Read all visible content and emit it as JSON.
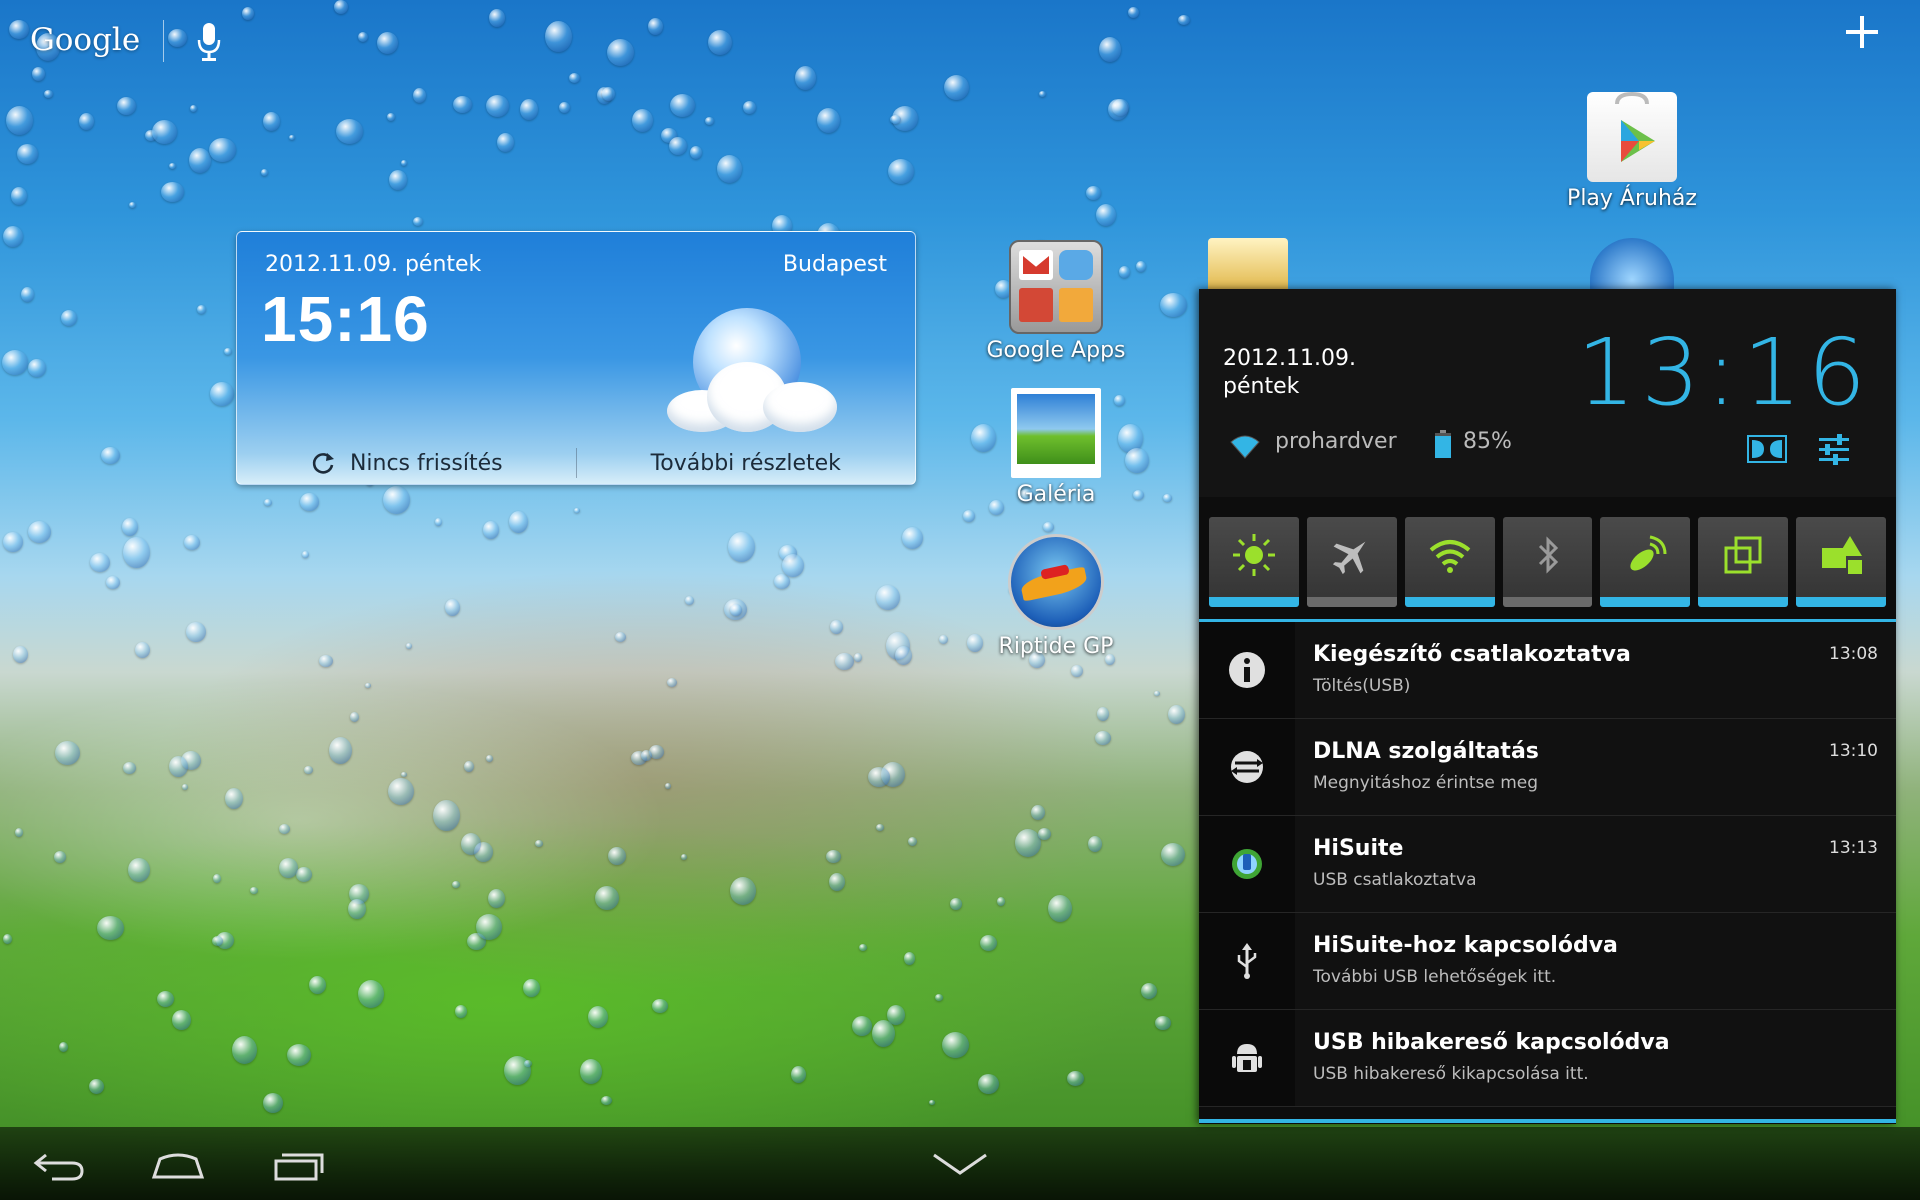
{
  "search_bar": {
    "logo_text": "Google"
  },
  "weather_widget": {
    "date": "2012.11.09.  péntek",
    "city": "Budapest",
    "time": "15:16",
    "refresh_label": "Nincs frissítés",
    "details_label": "További részletek"
  },
  "apps": [
    {
      "label": "Play Áruház",
      "icon": "play-store-icon"
    },
    {
      "label": "Google Apps",
      "icon": "google-apps-folder-icon"
    },
    {
      "label": "Galéria",
      "icon": "gallery-icon"
    },
    {
      "label": "Riptide GP",
      "icon": "riptide-gp-icon"
    }
  ],
  "notification_panel": {
    "date_line1": "2012.11.09.",
    "date_line2": "péntek",
    "clock": "13:16",
    "wifi_ssid": "prohardver",
    "battery": "85%",
    "toggles": [
      {
        "name": "brightness",
        "on": true
      },
      {
        "name": "airplane-mode",
        "on": false
      },
      {
        "name": "wifi",
        "on": true
      },
      {
        "name": "bluetooth",
        "on": false
      },
      {
        "name": "gps",
        "on": true
      },
      {
        "name": "auto-rotate",
        "on": true
      },
      {
        "name": "sync",
        "on": true
      }
    ],
    "notifications": [
      {
        "title": "Kiegészítő csatlakoztatva",
        "subtitle": "Töltés(USB)",
        "time": "13:08",
        "icon": "info-icon"
      },
      {
        "title": "DLNA szolgáltatás",
        "subtitle": "Megnyitáshoz érintse meg",
        "time": "13:10",
        "icon": "dlna-icon"
      },
      {
        "title": "HiSuite",
        "subtitle": "USB csatlakoztatva",
        "time": "13:13",
        "icon": "hisuite-icon"
      },
      {
        "title": "HiSuite-hoz kapcsolódva",
        "subtitle": "További USB lehetőségek itt.",
        "time": "",
        "icon": "usb-icon"
      },
      {
        "title": "USB hibakereső kapcsolódva",
        "subtitle": "USB hibakereső kikapcsolása itt.",
        "time": "",
        "icon": "android-debug-icon"
      }
    ]
  },
  "colors": {
    "accent": "#33b5e5",
    "panel_bg": "#0d0d0d"
  }
}
